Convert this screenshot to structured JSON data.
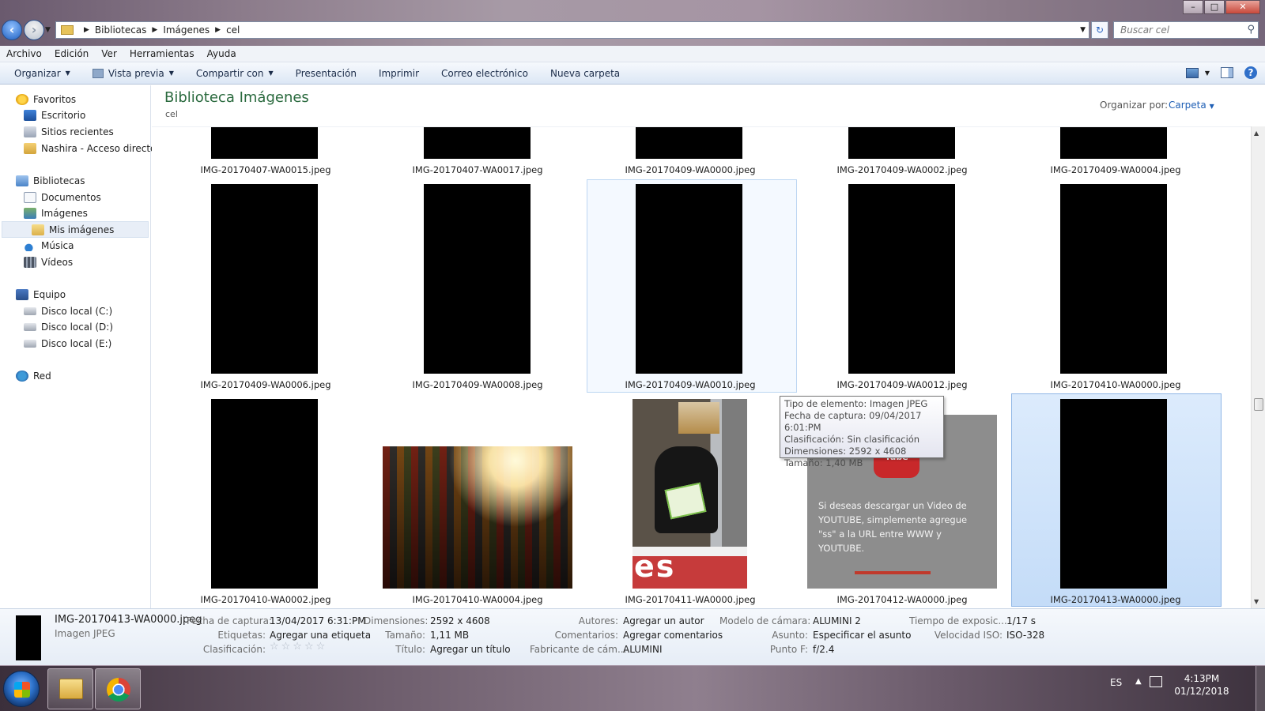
{
  "window": {
    "controls": {
      "minimize": "–",
      "maximize": "□",
      "close": "✕"
    }
  },
  "address": {
    "segments": [
      "Bibliotecas",
      "Imágenes",
      "cel"
    ],
    "search_placeholder": "Buscar cel"
  },
  "menu": [
    "Archivo",
    "Edición",
    "Ver",
    "Herramientas",
    "Ayuda"
  ],
  "toolbar": {
    "organize": "Organizar",
    "preview": "Vista previa",
    "share": "Compartir con",
    "slideshow": "Presentación",
    "print": "Imprimir",
    "email": "Correo electrónico",
    "new_folder": "Nueva carpeta"
  },
  "nav": {
    "favorites": "Favoritos",
    "desktop": "Escritorio",
    "recent": "Sitios recientes",
    "shortcut": "Nashira - Acceso directo",
    "libraries": "Bibliotecas",
    "documents": "Documentos",
    "pictures": "Imágenes",
    "my_pictures": "Mis imágenes",
    "music": "Música",
    "videos": "Vídeos",
    "computer": "Equipo",
    "disk_c": "Disco local (C:)",
    "disk_d": "Disco local (D:)",
    "disk_e": "Disco local (E:)",
    "network": "Red"
  },
  "content": {
    "title": "Biblioteca Imágenes",
    "subtitle": "cel",
    "arrange_label": "Organizar por:",
    "arrange_value": "Carpeta"
  },
  "files": {
    "row1": [
      "IMG-20170407-WA0015.jpeg",
      "IMG-20170407-WA0017.jpeg",
      "IMG-20170409-WA0000.jpeg",
      "IMG-20170409-WA0002.jpeg",
      "IMG-20170409-WA0004.jpeg"
    ],
    "row2": [
      "IMG-20170409-WA0006.jpeg",
      "IMG-20170409-WA0008.jpeg",
      "IMG-20170409-WA0010.jpeg",
      "IMG-20170409-WA0012.jpeg",
      "IMG-20170410-WA0000.jpeg"
    ],
    "row3": [
      "IMG-20170410-WA0002.jpeg",
      "IMG-20170410-WA0004.jpeg",
      "IMG-20170411-WA0000.jpeg",
      "IMG-20170412-WA0000.jpeg",
      "IMG-20170413-WA0000.jpeg"
    ]
  },
  "thumb_text": {
    "yt_logo": "Tube",
    "yt_message": "Si deseas descargar un Video de YOUTUBE, simplemente agregue \"ss\" a la URL entre WWW y YOUTUBE.",
    "store_text": "es"
  },
  "tooltip": {
    "type": "Tipo de elemento: Imagen JPEG",
    "date": "Fecha de captura: 09/04/2017 6:01:PM",
    "rating": "Clasificación: Sin clasificación",
    "dimensions": "Dimensiones: 2592 x 4608",
    "size": "Tamaño: 1,40 MB"
  },
  "details": {
    "name": "IMG-20170413-WA0000.jpeg",
    "type": "Imagen JPEG",
    "date_label": "Fecha de captura:",
    "date_value": "13/04/2017 6:31:PM",
    "tags_label": "Etiquetas:",
    "tags_value": "Agregar una etiqueta",
    "rating_label": "Clasificación:",
    "rating_stars": "☆☆☆☆☆",
    "dim_label": "Dimensiones:",
    "dim_value": "2592 x 4608",
    "size_label": "Tamaño:",
    "size_value": "1,11 MB",
    "title_label": "Título:",
    "title_value": "Agregar un título",
    "authors_label": "Autores:",
    "authors_value": "Agregar un autor",
    "comments_label": "Comentarios:",
    "comments_value": "Agregar comentarios",
    "maker_label": "Fabricante de cám...",
    "maker_value": "ALUMINI",
    "model_label": "Modelo de cámara:",
    "model_value": "ALUMINI 2",
    "subject_label": "Asunto:",
    "subject_value": "Especificar el asunto",
    "fstop_label": "Punto F:",
    "fstop_value": "f/2.4",
    "exposure_label": "Tiempo de exposic...",
    "exposure_value": "1/17 s",
    "iso_label": "Velocidad ISO:",
    "iso_value": "ISO-328"
  },
  "taskbar": {
    "language": "ES",
    "time": "4:13PM",
    "date": "01/12/2018"
  }
}
